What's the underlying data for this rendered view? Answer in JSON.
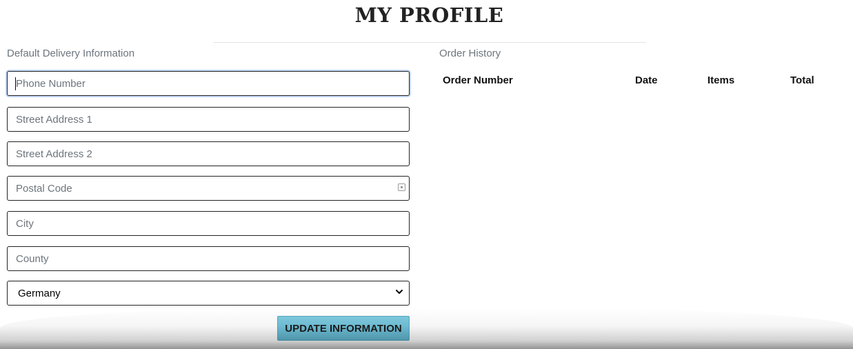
{
  "header": {
    "title": "MY PROFILE"
  },
  "delivery": {
    "section_label": "Default Delivery Information",
    "phone": {
      "placeholder": "Phone Number",
      "value": ""
    },
    "street1": {
      "placeholder": "Street Address 1",
      "value": ""
    },
    "street2": {
      "placeholder": "Street Address 2",
      "value": ""
    },
    "postal": {
      "placeholder": "Postal Code",
      "value": ""
    },
    "city": {
      "placeholder": "City",
      "value": ""
    },
    "county": {
      "placeholder": "County",
      "value": ""
    },
    "country": {
      "selected": "Germany"
    },
    "update_button_label": "UPDATE INFORMATION"
  },
  "orders": {
    "section_label": "Order History",
    "columns": [
      "Order Number",
      "Date",
      "Items",
      "Total"
    ],
    "rows": []
  },
  "colors": {
    "button": "#6fc0d8",
    "focus_ring": "#c3d6f4",
    "muted_text": "#6c757d"
  },
  "icons": {
    "autofill": "contact-card-icon",
    "select": "chevron-down-icon"
  }
}
